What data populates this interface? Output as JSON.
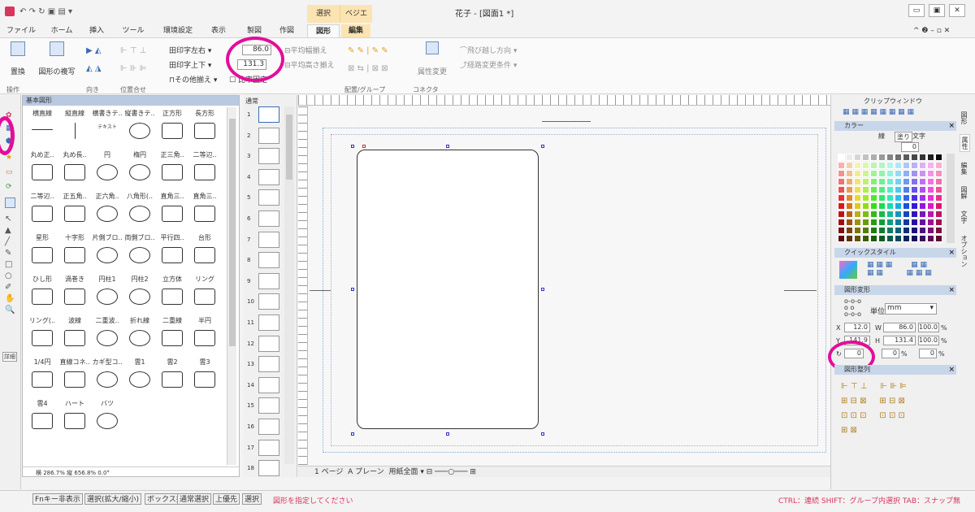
{
  "window": {
    "title": "花子 - [図面1 *]",
    "context_tabs": [
      "選択",
      "ベジエ"
    ]
  },
  "tabs": [
    {
      "label": "ファイル"
    },
    {
      "label": "ホーム"
    },
    {
      "label": "挿入"
    },
    {
      "label": "ツール"
    },
    {
      "label": "環境設定"
    },
    {
      "label": "表示"
    },
    {
      "label": "製図"
    },
    {
      "label": "作図"
    },
    {
      "label": "図形"
    },
    {
      "label": "編集"
    }
  ],
  "ribbon": {
    "replace": "置換",
    "dup": "図形の複写",
    "groups": [
      "操作",
      "向き",
      "位置合せ",
      "配置/グループ",
      "コネクタ"
    ],
    "align": [
      "印字左右",
      "印字上下",
      "その他揃え"
    ],
    "width_value": "86.0",
    "height_value": "131.3",
    "ratio_lock": "比率固定",
    "avg_width": "平均幅揃え",
    "avg_height": "平均高さ揃え",
    "attr": "属性変更",
    "jump_dir": "飛び越し方向",
    "route": "経路変更条件"
  },
  "palette": {
    "title": "基本図形",
    "shapes": [
      "横直線",
      "縦直線",
      "横書きテ..",
      "縦書きテ..",
      "正方形",
      "長方形",
      "丸め正..",
      "丸め長..",
      "円",
      "楕円",
      "正三角..",
      "二等辺..",
      "二等辺..",
      "正五角..",
      "正六角..",
      "八角形(..",
      "直角三..",
      "直角三..",
      "星形",
      "十字形",
      "片側ブロ..",
      "両側ブロ..",
      "平行四..",
      "台形",
      "ひし形",
      "渦巻き",
      "円柱1",
      "円柱2",
      "立方体",
      "リング",
      "リング(..",
      "波線",
      "二重波..",
      "折れ線",
      "二重線",
      "半円",
      "1/4円",
      "直線コネ..",
      "カギ型コ..",
      "雲1",
      "雲2",
      "雲3",
      "雲4",
      "ハート",
      "バツ"
    ],
    "text_sample": "テキスト",
    "footer": "横 286.7% 縦 656.8%  0.0°"
  },
  "thumbs": {
    "label": "通常",
    "pages": [
      "1",
      "2",
      "3",
      "4",
      "5",
      "6",
      "7",
      "8",
      "9",
      "10",
      "11",
      "12",
      "13",
      "14",
      "15",
      "16",
      "17",
      "18"
    ]
  },
  "canvas_bar": {
    "page": "1 ページ",
    "plane": "A プレーン",
    "view": "用紙全面"
  },
  "rpanel": {
    "title": "クリップウィンドウ",
    "color": {
      "title": "カラー",
      "tabs": [
        "線",
        "塗り",
        "文字"
      ],
      "opacity": "0"
    },
    "quick": {
      "title": "クイックスタイル"
    },
    "transform": {
      "title": "図形変形",
      "unit_label": "単位",
      "unit": "mm",
      "x": "12.0",
      "w": "86.0",
      "w_pct": "100.0",
      "y": "141.9",
      "h": "131.4",
      "h_pct": "100.0",
      "angle": "0",
      "skew_x": "0",
      "skew_y": "0"
    },
    "align": {
      "title": "図形整列"
    },
    "side_tabs": [
      "図形",
      "属性",
      "編集",
      "図解",
      "文字",
      "オプション"
    ]
  },
  "status": {
    "buttons": [
      "Fnキー非表示",
      "選択(拡大/縮小)",
      "ボックス掛",
      "通常選択",
      "上優先",
      "選択"
    ],
    "message": "図形を指定してください",
    "hint": "CTRL：連続 SHIFT：グループ内選択 TAB：スナップ無"
  },
  "colors": {
    "accent": "#e30d9a",
    "select_tab": "#fce4b2",
    "ribbon_border": "#d4d4d4"
  }
}
